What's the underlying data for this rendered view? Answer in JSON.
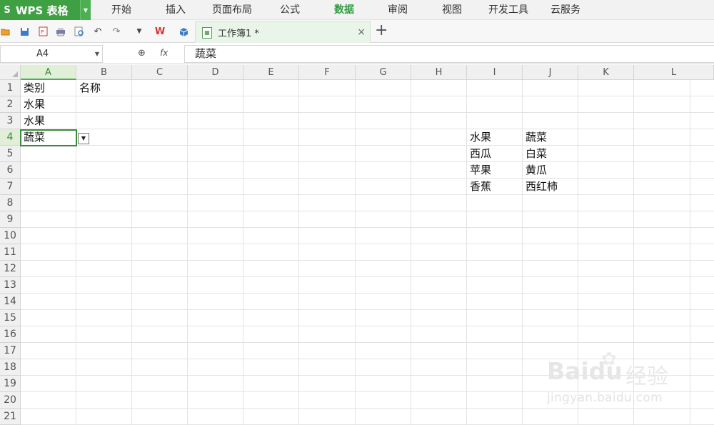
{
  "app": {
    "title": "WPS 表格",
    "logo_letter": "S"
  },
  "menu": [
    "开始",
    "插入",
    "页面布局",
    "公式",
    "数据",
    "审阅",
    "视图",
    "开发工具",
    "云服务"
  ],
  "menu_active": "数据",
  "toolbar_icons": [
    "open-icon",
    "save-icon",
    "export-pdf-icon",
    "print-icon",
    "print-preview-icon",
    "undo-icon",
    "redo-icon",
    "dropdown-icon",
    "wps-icon",
    "cube-icon"
  ],
  "tab": {
    "title": "工作簿1 *",
    "close": "×",
    "new": "+"
  },
  "formula_bar": {
    "name_box": "A4",
    "fx": "fx",
    "content": "蔬菜"
  },
  "columns": [
    "A",
    "B",
    "C",
    "D",
    "E",
    "F",
    "G",
    "H",
    "I",
    "J",
    "K",
    "L"
  ],
  "selected_column": "A",
  "rows": [
    "1",
    "2",
    "3",
    "4",
    "5",
    "6",
    "7",
    "8",
    "9",
    "10",
    "11",
    "12",
    "13",
    "14",
    "15",
    "16",
    "17",
    "18",
    "19",
    "20",
    "21"
  ],
  "selected_row": "4",
  "cells": {
    "A1": "类别",
    "B1": "名称",
    "A2": "水果",
    "A3": "水果",
    "A4": "蔬菜",
    "I4": "水果",
    "J4": "蔬菜",
    "I5": "西瓜",
    "J5": "白菜",
    "I6": "苹果",
    "J6": "黄瓜",
    "I7": "香蕉",
    "J7": "西红柿"
  },
  "watermark": {
    "logo": "Baidu",
    "cn": "经验",
    "url": "jingyan.baidu.com"
  },
  "colors": {
    "accent": "#3f9f43",
    "active_menu": "#2e9b3f"
  }
}
